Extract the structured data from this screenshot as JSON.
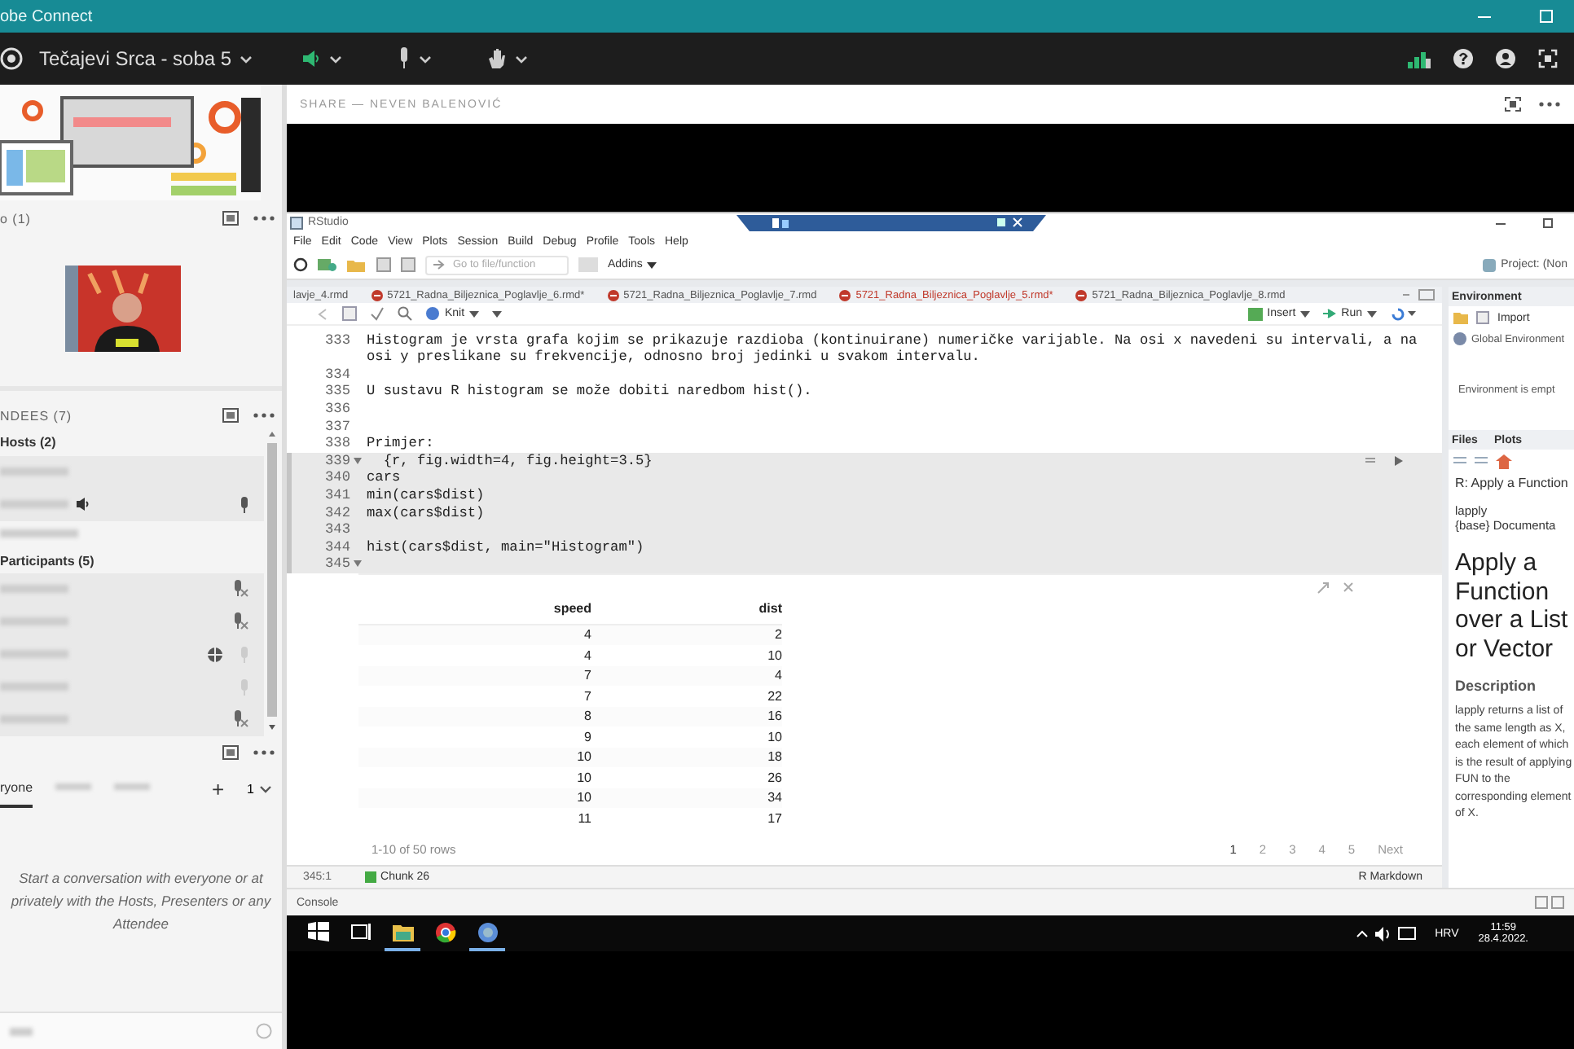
{
  "window": {
    "title": "obe Connect"
  },
  "toolbar": {
    "room": "Tečajevi Srca - soba 5"
  },
  "video_pod": {
    "title": "o (1)"
  },
  "attendees_pod": {
    "title": "NDEES (7)",
    "groups": [
      {
        "kind": "heading",
        "label": "Hosts (2)",
        "rows": [
          {
            "kind": "plain"
          },
          {
            "kind": "speaking"
          }
        ]
      },
      {
        "kind": "blurred-heading"
      },
      {
        "kind": "heading",
        "label": "Participants (5)",
        "rows": [
          {
            "kind": "mic-off"
          },
          {
            "kind": "mic-off"
          },
          {
            "kind": "globe"
          },
          {
            "kind": "mic-faint"
          },
          {
            "kind": "mic-off"
          }
        ]
      }
    ]
  },
  "chat_pod": {
    "tabs": [
      {
        "label": "ryone",
        "selected": true
      },
      {
        "selected": false
      },
      {
        "selected": false
      }
    ],
    "add": "+",
    "count": "1",
    "message": "Start a conversation with everyone or at privately with the Hosts, Presenters or any Attendee"
  },
  "share": {
    "title": "SHARE — NEVEN BALENOVIĆ"
  },
  "rstudio": {
    "title": "RStudio",
    "menu": [
      "File",
      "Edit",
      "Code",
      "View",
      "Plots",
      "Session",
      "Build",
      "Debug",
      "Profile",
      "Tools",
      "Help"
    ],
    "goto_placeholder": "Go to file/function",
    "addins": "Addins",
    "project": "Project: (Non",
    "editor_tabs": [
      {
        "label": "lavje_4.rmd",
        "selected": false,
        "modified": false
      },
      {
        "label": "5721_Radna_Biljeznica_Poglavlje_6.rmd*",
        "selected": false,
        "modified": true
      },
      {
        "label": "5721_Radna_Biljeznica_Poglavlje_7.rmd",
        "selected": false,
        "modified": true
      },
      {
        "label": "5721_Radna_Biljeznica_Poglavlje_5.rmd*",
        "selected": true,
        "modified": true
      },
      {
        "label": "5721_Radna_Biljeznica_Poglavlje_8.rmd",
        "selected": false,
        "modified": true
      }
    ],
    "knit": "Knit",
    "insert": "Insert",
    "run": "Run",
    "code_lines": [
      {
        "num": "333",
        "text": "Histogram je vrsta grafa kojim se prikazuje razdioba (kontinuirane) numeričke varijable. Na osi x navedeni su intervali, a na",
        "chunk": false,
        "fold": false
      },
      {
        "text": "osi y preslikane su frekvencije, odnosno broj jedinki u svakom intervalu.",
        "chunk": false,
        "fold": false
      },
      {
        "num": "334",
        "chunk": false,
        "fold": false
      },
      {
        "num": "335",
        "text": "U sustavu R histogram se može dobiti naredbom hist().",
        "chunk": false,
        "fold": false
      },
      {
        "num": "336",
        "chunk": false,
        "fold": false
      },
      {
        "num": "337",
        "chunk": false,
        "fold": false
      },
      {
        "num": "338",
        "text": "Primjer:",
        "chunk": false,
        "fold": false
      },
      {
        "num": "339",
        "text": "  {r, fig.width=4, fig.height=3.5}",
        "chunk": true,
        "fold": true
      },
      {
        "num": "340",
        "text": "cars",
        "chunk": true,
        "fold": false
      },
      {
        "num": "341",
        "text": "min(cars$dist)",
        "chunk": true,
        "fold": false
      },
      {
        "num": "342",
        "text": "max(cars$dist)",
        "chunk": true,
        "fold": false
      },
      {
        "num": "343",
        "chunk": true,
        "fold": false
      },
      {
        "num": "344",
        "text": "hist(cars$dist, main=\"Histogram\")",
        "chunk": true,
        "fold": false
      },
      {
        "num": "345",
        "chunk": true,
        "fold": true
      }
    ],
    "output": {
      "columns": [
        "speed",
        "dist"
      ],
      "rows": [
        [
          "4",
          "2"
        ],
        [
          "4",
          "10"
        ],
        [
          "7",
          "4"
        ],
        [
          "7",
          "22"
        ],
        [
          "8",
          "16"
        ],
        [
          "9",
          "10"
        ],
        [
          "10",
          "18"
        ],
        [
          "10",
          "26"
        ],
        [
          "10",
          "34"
        ],
        [
          "11",
          "17"
        ]
      ],
      "footer": "1-10 of 50 rows",
      "pages": [
        {
          "label": "1",
          "selected": true
        },
        {
          "label": "2",
          "selected": false
        },
        {
          "label": "3",
          "selected": false
        },
        {
          "label": "4",
          "selected": false
        },
        {
          "label": "5",
          "selected": false
        }
      ],
      "next": "Next"
    },
    "status": {
      "position": "345:1",
      "chunk": "Chunk 26",
      "mode": "R Markdown"
    },
    "console": "Console",
    "env_pane": {
      "tab": "Environment",
      "import": "Import",
      "scope": "Global Environment",
      "empty": "Environment is empt"
    },
    "help_pane": {
      "tabs": [
        "Files",
        "Plots"
      ],
      "topic": "R: Apply a Function",
      "fn": "lapply",
      "pkg": "{base} Documenta",
      "heading": "Apply a Function over a List or Vector",
      "section": "Description",
      "paragraph": "lapply returns a list of the same length as X, each element of which is the result of applying FUN to the corresponding element of X."
    }
  },
  "taskbar": {
    "apps": [
      {
        "kind": "start",
        "active": false
      },
      {
        "kind": "taskview",
        "active": false
      },
      {
        "kind": "folder",
        "active": true
      },
      {
        "kind": "chrome",
        "active": false
      },
      {
        "kind": "app",
        "active": true
      }
    ],
    "language": "HRV",
    "time": "11:59",
    "date": "28.4.2022."
  }
}
